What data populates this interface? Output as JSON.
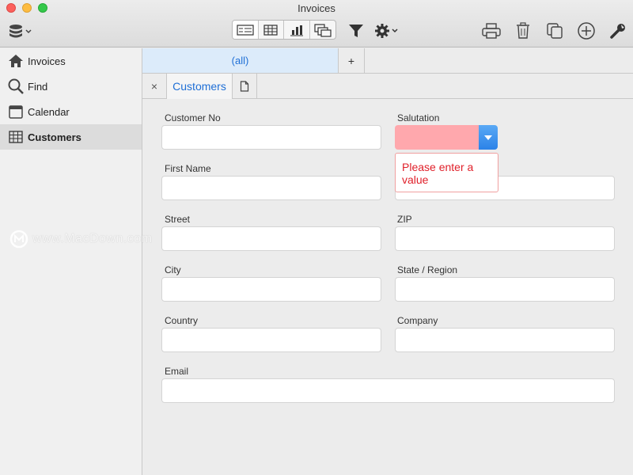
{
  "window": {
    "title": "Invoices"
  },
  "toolbar": {
    "icons": [
      "database-menu-icon",
      "form-view-icon",
      "table-view-icon",
      "chart-view-icon",
      "print-layout-view-icon",
      "filter-icon",
      "gear-icon",
      "print-icon",
      "trash-icon",
      "duplicate-icon",
      "add-icon",
      "wrench-icon"
    ]
  },
  "sidebar": {
    "items": [
      {
        "label": "Invoices",
        "icon": "home-icon"
      },
      {
        "label": "Find",
        "icon": "search-icon"
      },
      {
        "label": "Calendar",
        "icon": "calendar-icon"
      },
      {
        "label": "Customers",
        "icon": "table-icon",
        "selected": true
      }
    ]
  },
  "filters": {
    "active": "(all)",
    "add_label": "+"
  },
  "doc_tabs": {
    "close_label": "×",
    "active": "Customers"
  },
  "form": {
    "customer_no": {
      "label": "Customer No",
      "value": ""
    },
    "salutation": {
      "label": "Salutation",
      "value": "",
      "error": "Please enter a value"
    },
    "first_name": {
      "label": "First Name",
      "value": ""
    },
    "last_name": {
      "value": ""
    },
    "street": {
      "label": "Street",
      "value": ""
    },
    "zip": {
      "label": "ZIP",
      "value": ""
    },
    "city": {
      "label": "City",
      "value": ""
    },
    "state": {
      "label": "State / Region",
      "value": ""
    },
    "country": {
      "label": "Country",
      "value": ""
    },
    "company": {
      "label": "Company",
      "value": ""
    },
    "email": {
      "label": "Email",
      "value": ""
    }
  },
  "watermark": "www.MacDown.com",
  "colors": {
    "accent": "#1f6fd6",
    "error": "#e0202a",
    "invalid_field": "#ffa8ad"
  }
}
